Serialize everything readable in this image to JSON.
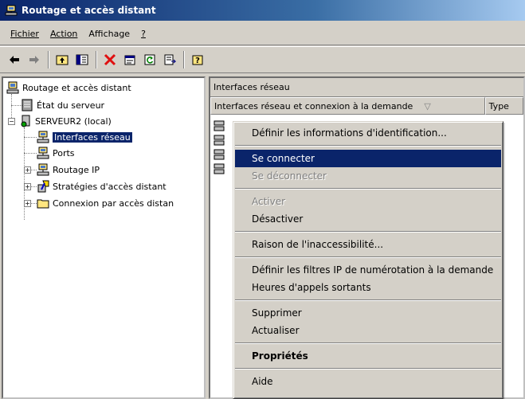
{
  "window": {
    "title": "Routage et accès distant"
  },
  "menubar": {
    "items": [
      {
        "label": "Fichier"
      },
      {
        "label": "Action"
      },
      {
        "label": "Affichage"
      },
      {
        "label": "?"
      }
    ]
  },
  "toolbar": {
    "buttons": [
      "back-arrow-icon",
      "forward-arrow-icon",
      "up-level-icon",
      "show-hide-tree-icon",
      "delete-icon",
      "properties-icon",
      "refresh-icon",
      "export-list-icon",
      "help-icon"
    ]
  },
  "tree": {
    "root": "Routage et accès distant",
    "server_status": "État du serveur",
    "server": "SERVEUR2 (local)",
    "network_interfaces": "Interfaces réseau",
    "ports": "Ports",
    "ip_routing": "Routage IP",
    "remote_access_policies": "Stratégies d'accès distant",
    "remote_access_logging": "Connexion par accès distan"
  },
  "right_pane": {
    "header": "Interfaces réseau",
    "columns": [
      {
        "label": "Interfaces réseau et connexion à la demande"
      },
      {
        "label": "Type"
      }
    ]
  },
  "context_menu": {
    "set_credentials": "Définir les informations d'identification...",
    "connect": "Se connecter",
    "disconnect": "Se déconnecter",
    "enable": "Activer",
    "disable": "Désactiver",
    "unreachability_reason": "Raison de l'inaccessibilité...",
    "demand_dial_filters": "Définir les filtres IP de numérotation à la demande",
    "dial_out_hours": "Heures d'appels sortants",
    "delete": "Supprimer",
    "refresh": "Actualiser",
    "properties": "Propriétés",
    "help": "Aide"
  }
}
